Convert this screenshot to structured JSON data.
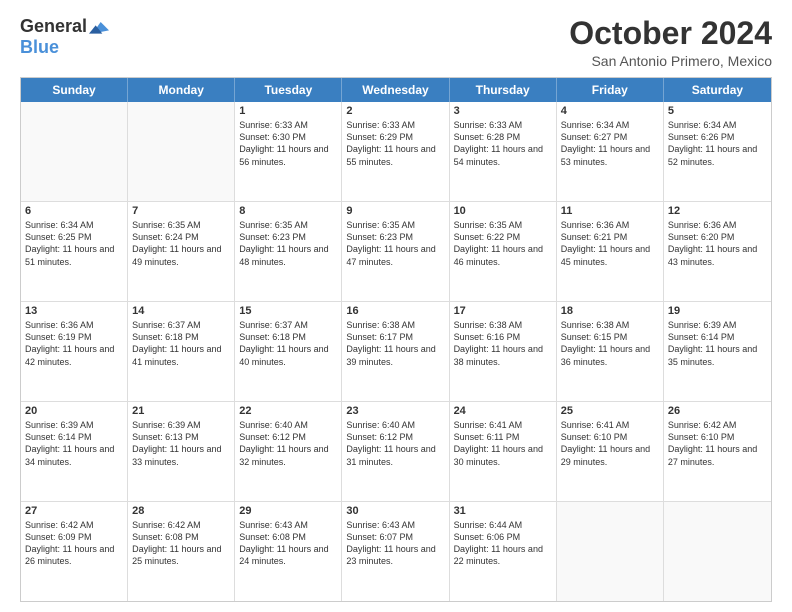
{
  "logo": {
    "general": "General",
    "blue": "Blue"
  },
  "header": {
    "month": "October 2024",
    "location": "San Antonio Primero, Mexico"
  },
  "days": [
    "Sunday",
    "Monday",
    "Tuesday",
    "Wednesday",
    "Thursday",
    "Friday",
    "Saturday"
  ],
  "rows": [
    [
      {
        "day": "",
        "info": ""
      },
      {
        "day": "",
        "info": ""
      },
      {
        "day": "1",
        "info": "Sunrise: 6:33 AM\nSunset: 6:30 PM\nDaylight: 11 hours and 56 minutes."
      },
      {
        "day": "2",
        "info": "Sunrise: 6:33 AM\nSunset: 6:29 PM\nDaylight: 11 hours and 55 minutes."
      },
      {
        "day": "3",
        "info": "Sunrise: 6:33 AM\nSunset: 6:28 PM\nDaylight: 11 hours and 54 minutes."
      },
      {
        "day": "4",
        "info": "Sunrise: 6:34 AM\nSunset: 6:27 PM\nDaylight: 11 hours and 53 minutes."
      },
      {
        "day": "5",
        "info": "Sunrise: 6:34 AM\nSunset: 6:26 PM\nDaylight: 11 hours and 52 minutes."
      }
    ],
    [
      {
        "day": "6",
        "info": "Sunrise: 6:34 AM\nSunset: 6:25 PM\nDaylight: 11 hours and 51 minutes."
      },
      {
        "day": "7",
        "info": "Sunrise: 6:35 AM\nSunset: 6:24 PM\nDaylight: 11 hours and 49 minutes."
      },
      {
        "day": "8",
        "info": "Sunrise: 6:35 AM\nSunset: 6:23 PM\nDaylight: 11 hours and 48 minutes."
      },
      {
        "day": "9",
        "info": "Sunrise: 6:35 AM\nSunset: 6:23 PM\nDaylight: 11 hours and 47 minutes."
      },
      {
        "day": "10",
        "info": "Sunrise: 6:35 AM\nSunset: 6:22 PM\nDaylight: 11 hours and 46 minutes."
      },
      {
        "day": "11",
        "info": "Sunrise: 6:36 AM\nSunset: 6:21 PM\nDaylight: 11 hours and 45 minutes."
      },
      {
        "day": "12",
        "info": "Sunrise: 6:36 AM\nSunset: 6:20 PM\nDaylight: 11 hours and 43 minutes."
      }
    ],
    [
      {
        "day": "13",
        "info": "Sunrise: 6:36 AM\nSunset: 6:19 PM\nDaylight: 11 hours and 42 minutes."
      },
      {
        "day": "14",
        "info": "Sunrise: 6:37 AM\nSunset: 6:18 PM\nDaylight: 11 hours and 41 minutes."
      },
      {
        "day": "15",
        "info": "Sunrise: 6:37 AM\nSunset: 6:18 PM\nDaylight: 11 hours and 40 minutes."
      },
      {
        "day": "16",
        "info": "Sunrise: 6:38 AM\nSunset: 6:17 PM\nDaylight: 11 hours and 39 minutes."
      },
      {
        "day": "17",
        "info": "Sunrise: 6:38 AM\nSunset: 6:16 PM\nDaylight: 11 hours and 38 minutes."
      },
      {
        "day": "18",
        "info": "Sunrise: 6:38 AM\nSunset: 6:15 PM\nDaylight: 11 hours and 36 minutes."
      },
      {
        "day": "19",
        "info": "Sunrise: 6:39 AM\nSunset: 6:14 PM\nDaylight: 11 hours and 35 minutes."
      }
    ],
    [
      {
        "day": "20",
        "info": "Sunrise: 6:39 AM\nSunset: 6:14 PM\nDaylight: 11 hours and 34 minutes."
      },
      {
        "day": "21",
        "info": "Sunrise: 6:39 AM\nSunset: 6:13 PM\nDaylight: 11 hours and 33 minutes."
      },
      {
        "day": "22",
        "info": "Sunrise: 6:40 AM\nSunset: 6:12 PM\nDaylight: 11 hours and 32 minutes."
      },
      {
        "day": "23",
        "info": "Sunrise: 6:40 AM\nSunset: 6:12 PM\nDaylight: 11 hours and 31 minutes."
      },
      {
        "day": "24",
        "info": "Sunrise: 6:41 AM\nSunset: 6:11 PM\nDaylight: 11 hours and 30 minutes."
      },
      {
        "day": "25",
        "info": "Sunrise: 6:41 AM\nSunset: 6:10 PM\nDaylight: 11 hours and 29 minutes."
      },
      {
        "day": "26",
        "info": "Sunrise: 6:42 AM\nSunset: 6:10 PM\nDaylight: 11 hours and 27 minutes."
      }
    ],
    [
      {
        "day": "27",
        "info": "Sunrise: 6:42 AM\nSunset: 6:09 PM\nDaylight: 11 hours and 26 minutes."
      },
      {
        "day": "28",
        "info": "Sunrise: 6:42 AM\nSunset: 6:08 PM\nDaylight: 11 hours and 25 minutes."
      },
      {
        "day": "29",
        "info": "Sunrise: 6:43 AM\nSunset: 6:08 PM\nDaylight: 11 hours and 24 minutes."
      },
      {
        "day": "30",
        "info": "Sunrise: 6:43 AM\nSunset: 6:07 PM\nDaylight: 11 hours and 23 minutes."
      },
      {
        "day": "31",
        "info": "Sunrise: 6:44 AM\nSunset: 6:06 PM\nDaylight: 11 hours and 22 minutes."
      },
      {
        "day": "",
        "info": ""
      },
      {
        "day": "",
        "info": ""
      }
    ]
  ]
}
